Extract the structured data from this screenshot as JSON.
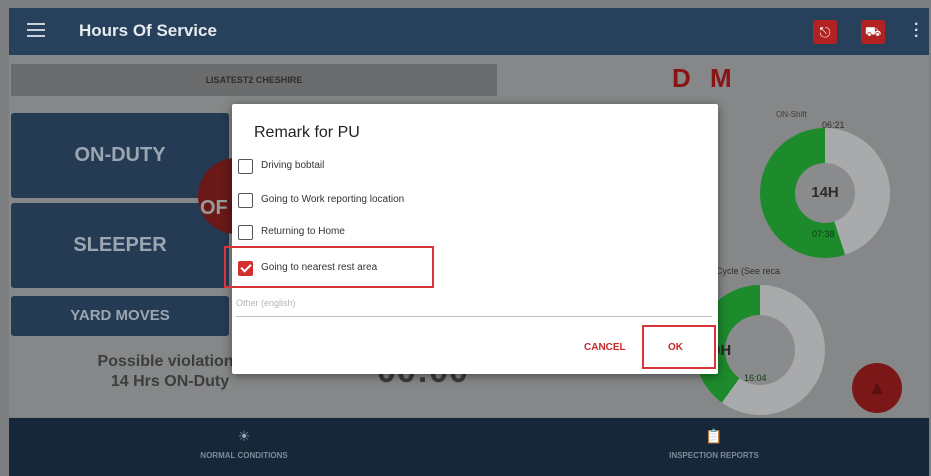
{
  "appbar": {
    "title": "Hours Of Service",
    "menu_icon": "hamburger-menu-icon",
    "alert_icon": "alarm-icon",
    "truck_icon": "truck-icon",
    "more_icon": "more-vert-icon",
    "color": "#27405b"
  },
  "dashboard": {
    "driver_name": "LISATEST2 CHESHIRE",
    "dm_label": "D M",
    "on_duty_label": "ON-DUTY",
    "sleeper_label": "SLEEPER",
    "yard_moves_label": "YARD MOVES",
    "off_label": "OF",
    "violation_line1": "Possible violation i",
    "violation_line2": "14 Hrs ON-Duty",
    "clock_text": "00:00",
    "on_shift_label": "ON-Shift",
    "on_shift_time": "06:21",
    "on_shift_hours": "14H",
    "on_shift_green_time": "07:38",
    "cycle_label": "Cycle (See reca",
    "cycle_partial": "0H",
    "cycle_green_time": "16:04",
    "status_color": "#253a53",
    "green_color": "#1d8a2c"
  },
  "bottom_nav": {
    "normal_conditions": "NORMAL CONDITIONS",
    "inspection_reports": "INSPECTION REPORTS",
    "normal_icon": "sun-icon",
    "inspection_icon": "clipboard-icon"
  },
  "dialog": {
    "title": "Remark for PU",
    "options": [
      {
        "label": "Driving bobtail",
        "checked": false
      },
      {
        "label": "Going to Work reporting location",
        "checked": false
      },
      {
        "label": "Returning to Home",
        "checked": false
      },
      {
        "label": "Going to nearest rest area",
        "checked": true
      }
    ],
    "other_placeholder": "Other (english)",
    "cancel_label": "CANCEL",
    "ok_label": "OK",
    "accent_color": "#d32f2f"
  }
}
